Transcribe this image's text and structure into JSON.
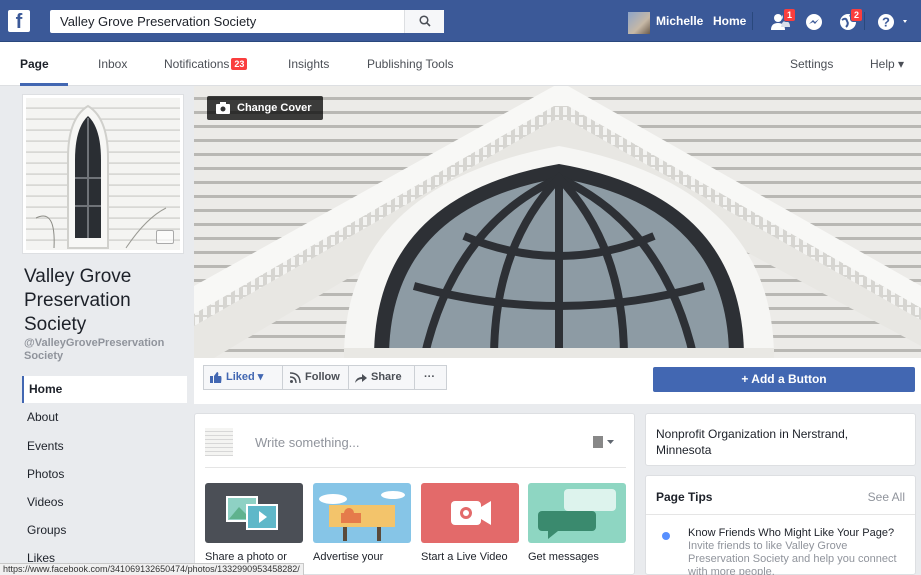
{
  "topbar": {
    "logo": "f",
    "search_value": "Valley Grove Preservation Society",
    "user_name": "Michelle",
    "home_label": "Home",
    "friend_requests_count": "1",
    "notifications_count": "2"
  },
  "subnav": {
    "tabs": [
      {
        "label": "Page"
      },
      {
        "label": "Inbox"
      },
      {
        "label": "Notifications"
      },
      {
        "label": "Insights"
      },
      {
        "label": "Publishing Tools"
      }
    ],
    "notifications_badge": "23",
    "settings_label": "Settings",
    "help_label": "Help ▾"
  },
  "profile": {
    "title": "Valley Grove Preservation Society",
    "handle": "@ValleyGrovePreservation Society"
  },
  "left_nav": {
    "items": [
      {
        "label": "Home"
      },
      {
        "label": "About"
      },
      {
        "label": "Events"
      },
      {
        "label": "Photos"
      },
      {
        "label": "Videos"
      },
      {
        "label": "Groups"
      },
      {
        "label": "Likes"
      }
    ]
  },
  "cover": {
    "change_cover_label": "Change Cover"
  },
  "actions": {
    "liked_label": "Liked ▾",
    "follow_label": "Follow",
    "share_label": "Share",
    "more_label": "···",
    "add_button_label": "+ Add a Button"
  },
  "composer": {
    "placeholder": "Write something...",
    "cards": [
      {
        "label": "Share a photo or"
      },
      {
        "label": "Advertise your"
      },
      {
        "label": "Start a Live Video"
      },
      {
        "label": "Get messages"
      }
    ]
  },
  "about": {
    "category": "Nonprofit Organization in Nerstrand, Minnesota"
  },
  "page_tips": {
    "title": "Page Tips",
    "see_all": "See All",
    "tip_title": "Know Friends Who Might Like Your Page?",
    "tip_desc": "Invite friends to like Valley Grove Preservation Society and help you connect with more people."
  },
  "status_bar": {
    "url": "https://www.facebook.com/341069132650474/photos/1332990953458282/"
  },
  "colors": {
    "brand": "#3b5998",
    "accent": "#4267b2",
    "badge": "#fa3e3e"
  }
}
